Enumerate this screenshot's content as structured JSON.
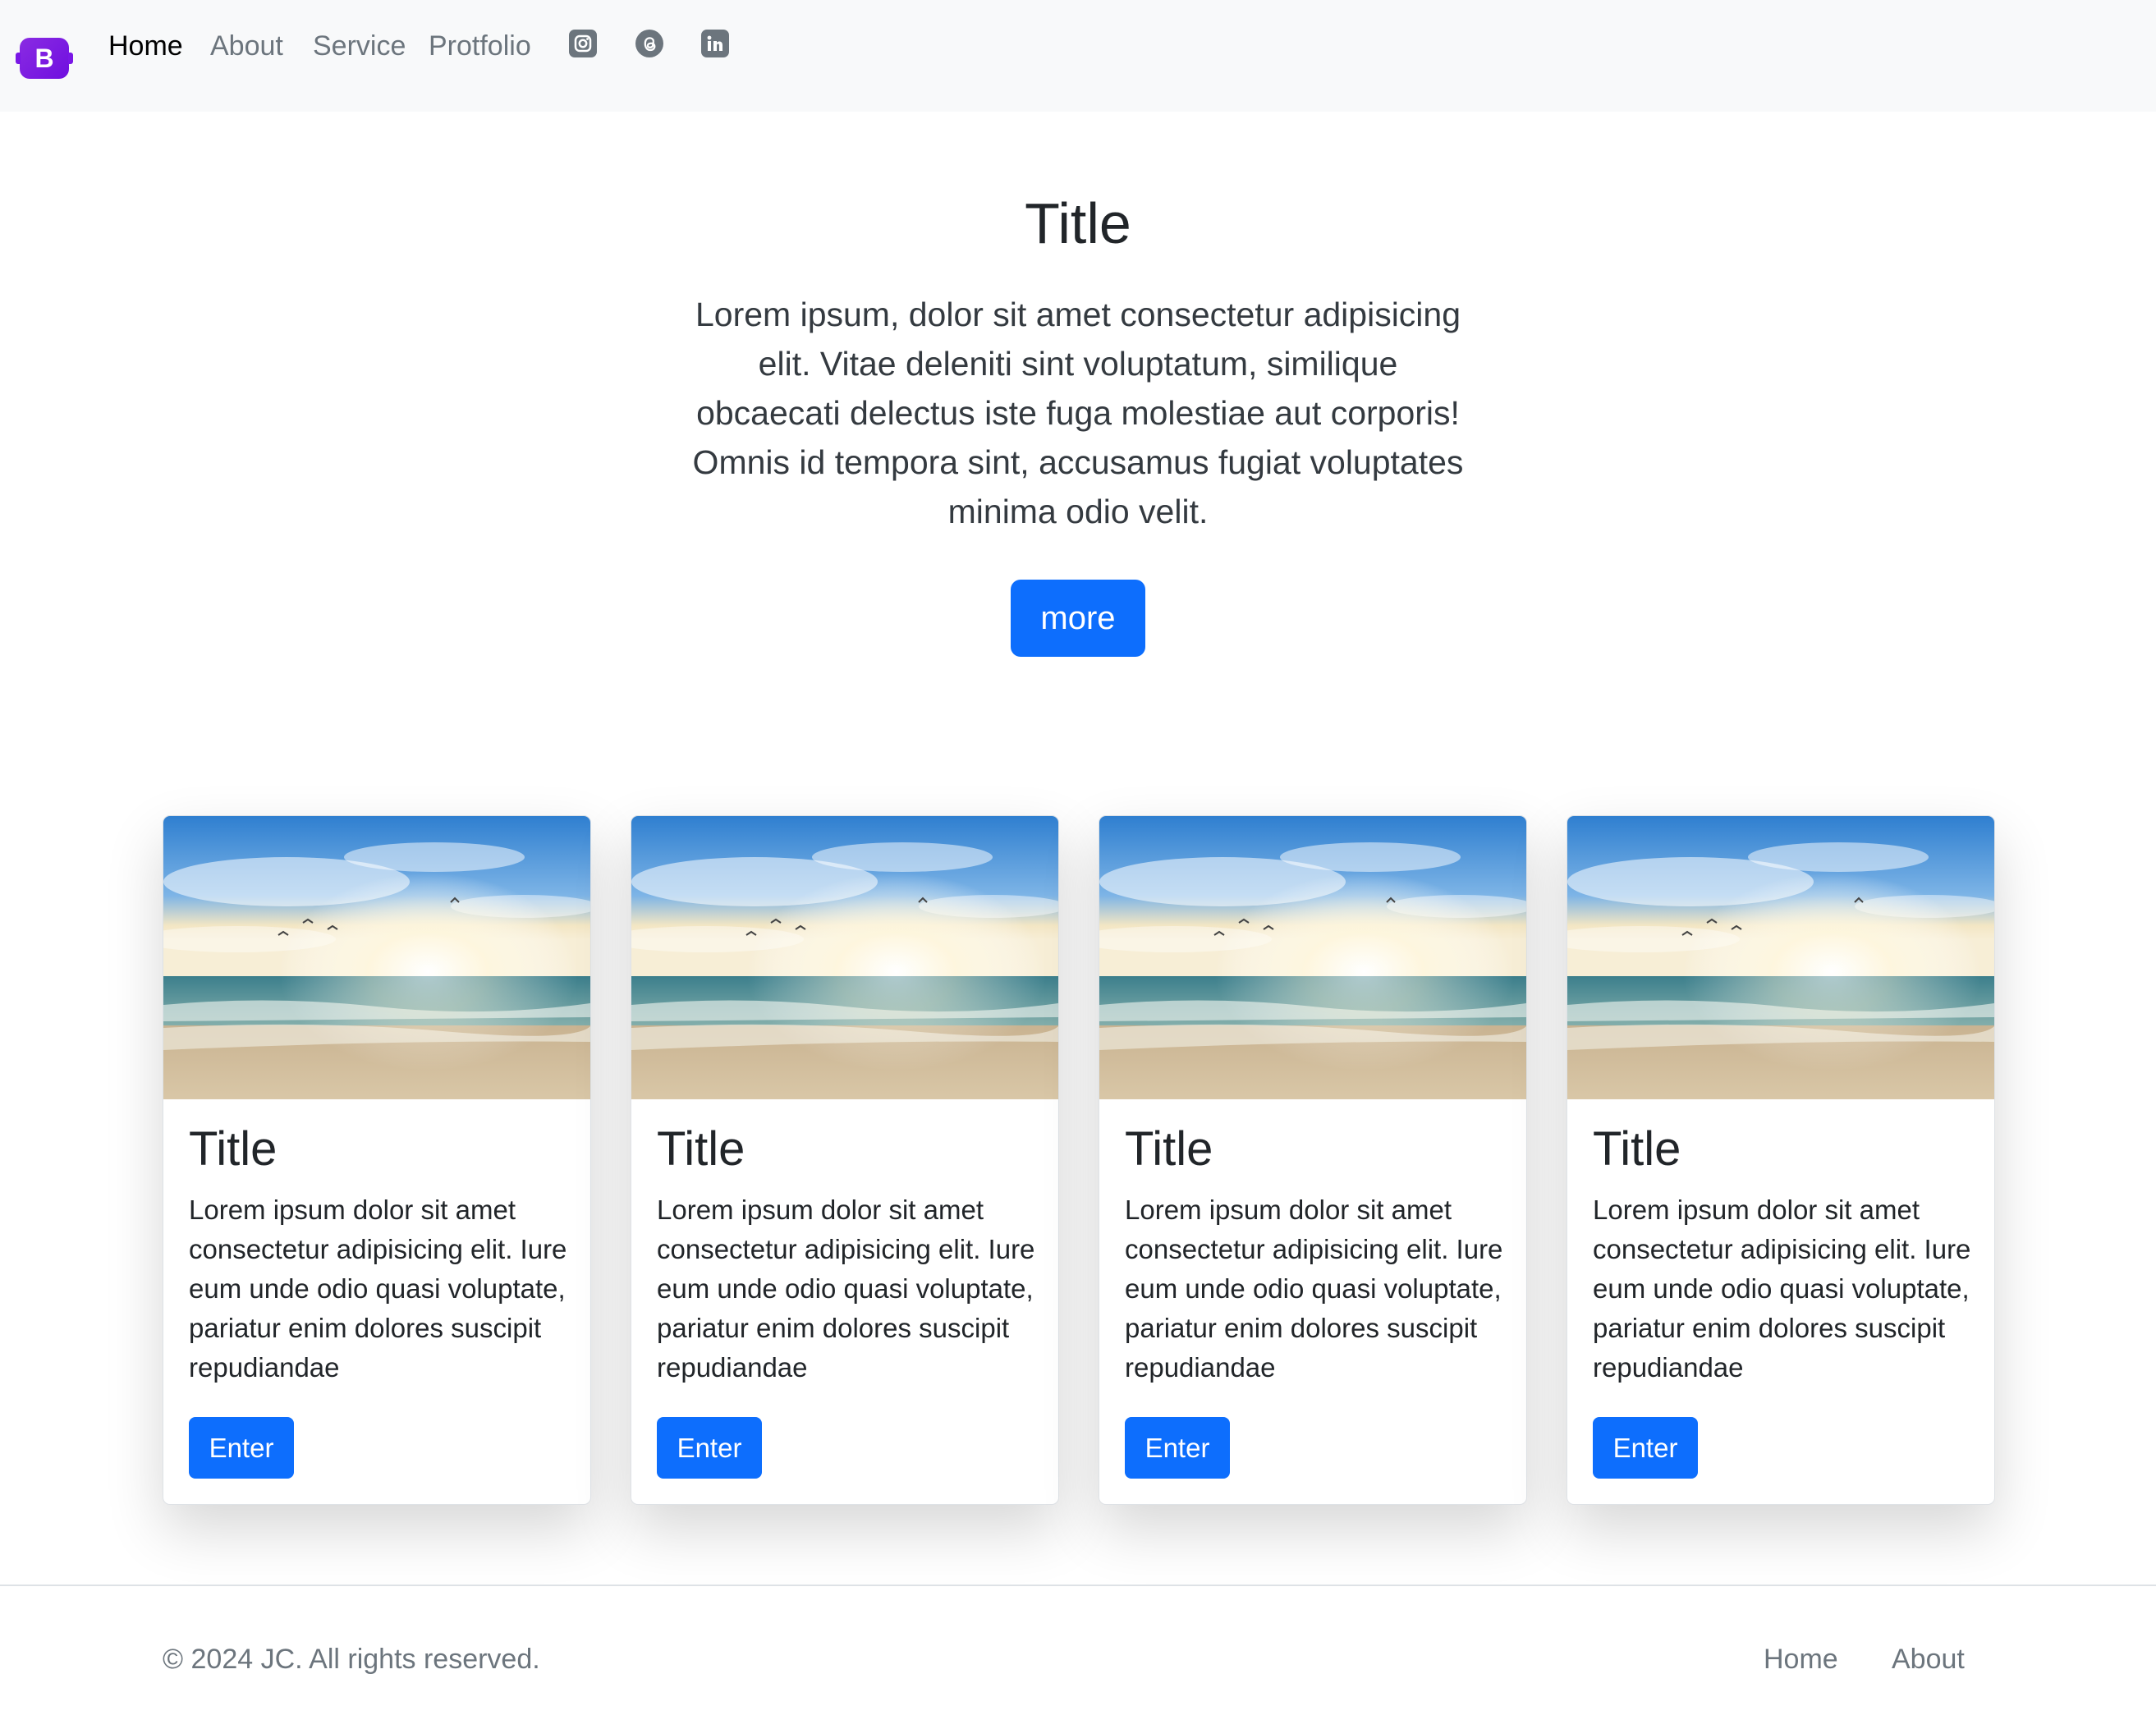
{
  "navbar": {
    "brand_letter": "B",
    "links": [
      "Home",
      "About",
      "Service",
      "Protfolio"
    ],
    "active_link": "Home",
    "social_icons": [
      "instagram-icon",
      "threads-icon",
      "linkedin-icon"
    ]
  },
  "hero": {
    "title": "Title",
    "text": "Lorem ipsum, dolor sit amet consectetur adipisicing elit. Vitae deleniti sint voluptatum, similique obcaecati delectus iste fuga molestiae aut corporis! Omnis id tempora sint, accusamus fugiat voluptates minima odio velit.",
    "button_label": "more"
  },
  "cards": [
    {
      "title": "Title",
      "text": "Lorem ipsum dolor sit amet consectetur adipisicing elit. Iure eum unde odio quasi voluptate, pariatur enim dolores suscipit repudiandae",
      "button_label": "Enter"
    },
    {
      "title": "Title",
      "text": "Lorem ipsum dolor sit amet consectetur adipisicing elit. Iure eum unde odio quasi voluptate, pariatur enim dolores suscipit repudiandae",
      "button_label": "Enter"
    },
    {
      "title": "Title",
      "text": "Lorem ipsum dolor sit amet consectetur adipisicing elit. Iure eum unde odio quasi voluptate, pariatur enim dolores suscipit repudiandae",
      "button_label": "Enter"
    },
    {
      "title": "Title",
      "text": "Lorem ipsum dolor sit amet consectetur adipisicing elit. Iure eum unde odio quasi voluptate, pariatur enim dolores suscipit repudiandae",
      "button_label": "Enter"
    }
  ],
  "footer": {
    "copyright": "© 2024 JC. All rights reserved.",
    "links": [
      "Home",
      "About"
    ]
  },
  "colors": {
    "primary": "#0d6efd",
    "brand": "#7a17e6",
    "navbar_bg": "#f8f9fa",
    "muted": "#6c757d"
  }
}
